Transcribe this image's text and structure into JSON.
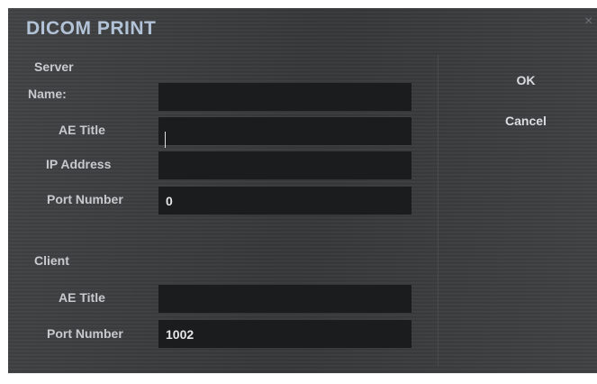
{
  "dialog": {
    "title": "DICOM PRINT",
    "close_glyph": "×"
  },
  "server": {
    "section_label": "Server",
    "name_label": "Name:",
    "name_value": "",
    "ae_title_label": "AE Title",
    "ae_title_value": "",
    "ip_label": "IP Address",
    "ip_value": "",
    "port_label": "Port Number",
    "port_value": "0"
  },
  "client": {
    "section_label": "Client",
    "ae_title_label": "AE Title",
    "ae_title_value": "",
    "port_label": "Port Number",
    "port_value": "1002"
  },
  "buttons": {
    "ok_label": "OK",
    "cancel_label": "Cancel"
  },
  "colors": {
    "title": "#b3c3d7",
    "panel": "#3a3b3d",
    "input_bg": "#1b1c1e"
  },
  "icons": {
    "close": "close-icon"
  }
}
